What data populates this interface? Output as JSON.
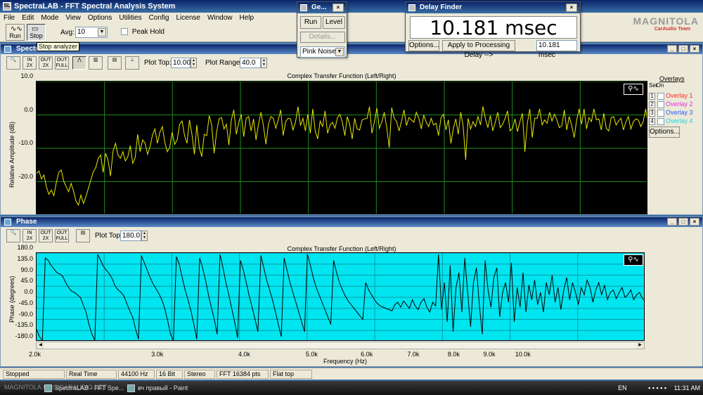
{
  "app": {
    "title": "SpectraLAB - FFT Spectral Analysis System"
  },
  "menu": [
    "File",
    "Edit",
    "Mode",
    "View",
    "Options",
    "Utilities",
    "Config",
    "License",
    "Window",
    "Help"
  ],
  "toolbar": {
    "run_label": "Run",
    "stop_label": "Stop",
    "avg_label": "Avg:",
    "avg_value": "10",
    "peak_hold_label": "Peak Hold",
    "tooltip": "Stop analyzer"
  },
  "generator": {
    "title": "Ge...",
    "run_label": "Run",
    "level_label": "Level",
    "details_label": "Details...",
    "signal": "Pink Noise"
  },
  "delay_finder": {
    "title": "Delay Finder",
    "value": "10.181 msec",
    "options_label": "Options...",
    "apply_label": "Apply to Processing Delay -->",
    "field_value": "10.181 msec"
  },
  "brand": {
    "logo": "MAGNITOLA",
    "sub": "CarAudio Team"
  },
  "spectrum": {
    "pane_title": "Spectrum",
    "icons": [
      "zoom-icon",
      "in-x-icon",
      "out-x-icon",
      "out-full-icon",
      "peak-icon",
      "bars-icon",
      "table-icon",
      "marker-icon"
    ],
    "plot_top_label": "Plot Top:",
    "plot_top": "10.00",
    "plot_range_label": "Plot Range:",
    "plot_range": "40.0",
    "overlays": {
      "title": "Overlays",
      "set_label": "Set",
      "on_label": "On",
      "items": [
        {
          "num": "1",
          "label": "Overlay 1",
          "color": "#ff2a2a"
        },
        {
          "num": "2",
          "label": "Overlay 2",
          "color": "#e830e8"
        },
        {
          "num": "3",
          "label": "Overlay 3",
          "color": "#2a5aff"
        },
        {
          "num": "4",
          "label": "Overlay 4",
          "color": "#20d8e8"
        }
      ],
      "options_label": "Options..."
    }
  },
  "phase": {
    "pane_title": "Phase",
    "plot_top_label": "Plot Top:",
    "plot_top": "180.0"
  },
  "chart_data": [
    {
      "type": "line",
      "title": "Complex Transfer Function (Left/Right)",
      "ylabel": "Relative Amplitude (dB)",
      "xlabel": "",
      "ylim": [
        -30,
        10
      ],
      "yticks": [
        "10.0",
        "0.0",
        "-10.0",
        "-20.0"
      ],
      "grid": true,
      "background": "#000000",
      "line_color": "#e8e800",
      "series": [
        {
          "values": [
            -17.5,
            -16.8,
            -19.2,
            -18.0,
            -21.5,
            -23.8,
            -22.5,
            -24.2,
            -20.3,
            -17.2,
            -16.5,
            -19.8,
            -21.5,
            -23.0,
            -20.5,
            -22.8,
            -25.8,
            -27.0,
            -24.0,
            -26.5,
            -24.5,
            -22.0,
            -19.5,
            -17.0,
            -15.8,
            -13.0,
            -12.0,
            -17.2,
            -11.5,
            -13.5,
            -18.3,
            -10.8,
            -8.5,
            -12.0,
            -13.0,
            -11.0,
            -13.8,
            -12.5,
            -9.2,
            -14.5,
            -12.8,
            -5.8,
            -11.0,
            -7.5,
            -8.5,
            -11.8,
            -9.5,
            -6.0,
            -4.2,
            -8.5,
            -5.2,
            -3.5,
            -8.2,
            -11.0,
            -9.8,
            -5.2,
            -8.8,
            -7.5,
            -2.8,
            -1.8,
            -6.2,
            -8.5,
            -1.5,
            -5.8,
            -11.8,
            -3.0,
            -9.8,
            -12.5,
            -5.8,
            -6.2,
            -0.2,
            -3.0,
            -11.5,
            -5.2,
            -1.2,
            -0.8,
            -4.2,
            -2.8,
            -9.0,
            -1.5,
            1.5,
            -5.8,
            -2.2,
            0.2,
            -6.5,
            -1.0,
            -0.5,
            -4.8,
            -1.2,
            -7.5,
            -2.8,
            0.8,
            -3.2,
            -8.8,
            -2.8,
            -0.5,
            -1.0,
            -4.0,
            -1.5,
            1.5,
            -6.2,
            -2.0,
            -1.0,
            -1.2,
            -4.5,
            -2.2,
            2.5,
            -3.2,
            -1.0,
            -4.8,
            0.2,
            -5.5,
            1.8,
            -4.8,
            -7.2,
            -1.8,
            -3.5,
            1.2,
            -5.5,
            -3.0,
            -2.2,
            -4.0,
            -0.8,
            0.2,
            -2.2,
            -6.2,
            -0.5,
            -3.0,
            -7.2,
            -1.0,
            -4.2,
            -4.5,
            -1.5,
            -1.2,
            -1.0,
            2.5,
            -5.5,
            -2.0,
            2.0,
            -4.0,
            -2.2,
            0.8,
            -3.8,
            -9.8,
            2.2,
            -1.0,
            -2.0,
            -4.8,
            -1.8,
            1.5,
            -3.2,
            -0.8,
            -1.5,
            -2.2,
            0.8,
            -1.0,
            -4.2,
            0.0,
            -2.2,
            -3.5,
            -1.0,
            -3.0,
            -2.5,
            -6.2,
            -0.8,
            0.2,
            -4.5,
            -1.5,
            -8.5,
            -4.0,
            -1.2,
            -5.8,
            0.8,
            -3.5,
            -13.5,
            -1.0,
            -4.2,
            -2.0,
            -3.5,
            -0.5,
            -3.0,
            2.5,
            -1.2,
            -3.8,
            -0.2,
            -4.8,
            -2.2,
            0.8,
            -3.8,
            -2.8,
            -1.0,
            1.2,
            -4.8,
            -4.0,
            -1.2,
            -5.0,
            -2.0,
            0.5,
            -11.0,
            -2.5,
            1.8,
            -6.8,
            -1.0,
            -1.0,
            1.8,
            -3.0,
            -1.5,
            -2.5,
            0.8,
            -1.8,
            0.2,
            -1.5,
            -3.8,
            -3.2,
            1.5,
            -4.5,
            -0.5,
            -3.2,
            -6.8,
            -1.5,
            1.8,
            -2.8,
            1.8,
            -4.2,
            -0.8,
            -2.0,
            1.8,
            -1.5,
            -1.2,
            -4.5,
            0.5,
            -4.0,
            -4.8,
            -0.8,
            -0.5,
            -3.0,
            -1.8,
            -1.0,
            -4.5,
            -2.0,
            -0.5,
            -4.2,
            -2.0,
            -1.2,
            -1.5,
            -3.5,
            -2.0,
            1.8,
            -3.5
          ]
        }
      ]
    },
    {
      "type": "line",
      "title": "Complex Transfer Function (Left/Right)",
      "ylabel": "Phase (degrees)",
      "xlabel": "Frequency (Hz)",
      "ylim": [
        -180,
        180
      ],
      "yticks": [
        "180.0",
        "135.0",
        "90.0",
        "45.0",
        "0.0",
        "-45.0",
        "-90.0",
        "-135.0",
        "-180.0"
      ],
      "xscale": "log",
      "xlim": [
        2000,
        15000
      ],
      "xticks": [
        {
          "v": 2000,
          "label": "2.0k"
        },
        {
          "v": 3000,
          "label": "3.0k"
        },
        {
          "v": 4000,
          "label": "4.0k"
        },
        {
          "v": 5000,
          "label": "5.0k"
        },
        {
          "v": 6000,
          "label": "6.0k"
        },
        {
          "v": 7000,
          "label": "7.0k"
        },
        {
          "v": 8000,
          "label": "8.0k"
        },
        {
          "v": 9000,
          "label": "9.0k"
        },
        {
          "v": 10000,
          "label": "10.0k"
        }
      ],
      "grid": true,
      "background": "#00e5f0",
      "line_color": "#000000",
      "series": [
        {
          "values": [
            -130,
            -160,
            -175,
            160,
            150,
            130,
            115,
            100,
            95,
            85,
            60,
            40,
            25,
            20,
            10,
            0,
            -30,
            -60,
            -110,
            -150,
            -175,
            175,
            150,
            125,
            110,
            95,
            75,
            45,
            30,
            20,
            5,
            -25,
            -55,
            -80,
            -130,
            -170,
            170,
            140,
            110,
            80,
            55,
            35,
            15,
            -10,
            -45,
            -95,
            -150,
            -175,
            165,
            135,
            80,
            30,
            -10,
            -55,
            -110,
            -170,
            160,
            120,
            70,
            10,
            -40,
            -90,
            -150,
            175,
            120,
            60,
            10,
            -45,
            -100,
            -165,
            150,
            110,
            60,
            5,
            -40,
            -90,
            -140,
            170,
            120,
            70,
            30,
            -10,
            -60,
            -110,
            -160,
            160,
            110,
            60,
            20,
            -20,
            -60,
            -100,
            -140,
            175,
            130,
            80,
            40,
            10,
            -20,
            -50,
            -80,
            -110,
            150,
            100,
            60,
            30,
            5,
            -15,
            -30,
            -45,
            -60,
            -75,
            -90,
            60,
            30,
            10,
            -10,
            -25,
            -35,
            -40,
            -45,
            -50,
            -55,
            -30,
            -20,
            -40,
            -15,
            -30,
            -45,
            -10,
            -35,
            -50,
            -20,
            -5,
            -40,
            -60,
            -20,
            -35,
            175,
            -50,
            60,
            -100,
            130,
            -140,
            40,
            100,
            -60,
            160,
            20,
            -120,
            60,
            120,
            -30,
            -150,
            150,
            30,
            -40,
            80,
            120,
            -80,
            20,
            60,
            -20,
            140,
            -100,
            40,
            -40,
            100,
            -60,
            50,
            -10,
            70,
            -30,
            20,
            -60,
            60,
            10,
            90,
            -20,
            40,
            -50,
            30,
            80,
            -10,
            60,
            20,
            -30,
            40,
            10,
            70,
            40,
            -20,
            30,
            60,
            10,
            50,
            -10,
            20,
            30,
            -5,
            20,
            40,
            0,
            10,
            30,
            -10,
            10,
            20,
            -5,
            -15
          ]
        }
      ]
    }
  ],
  "status": [
    "Stopped",
    "Real Time",
    "44100 Hz",
    "16 Bit",
    "Stereo",
    "FFT 16384 pts",
    "Flat top"
  ],
  "taskbar": {
    "tasks": [
      "SpectraLAB - FFT Spe...",
      "вч правый - Paint"
    ],
    "watermark": "MAGNITOLA.ORG/CARAUDIO.NET",
    "lang": "EN",
    "time": "11:31 AM"
  }
}
